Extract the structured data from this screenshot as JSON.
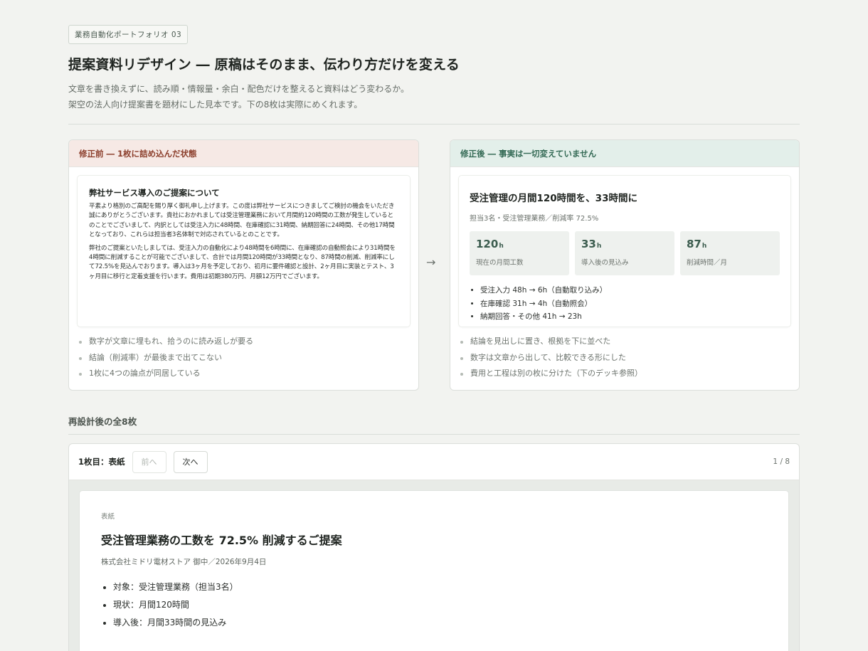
{
  "header": {
    "badge": "業務自動化ポートフォリオ 03",
    "title": "提案資料リデザイン ― 原稿はそのまま、伝わり方だけを変える",
    "lead_1": "文章を書き換えずに、読み順・情報量・余白・配色だけを整えると資料はどう変わるか。",
    "lead_2": "架空の法人向け提案書を題材にした見本です。下の8枚は実際にめくれます。"
  },
  "before": {
    "head": "修正前 ― 1枚に詰め込んだ状態",
    "slide_title": "弊社サービス導入のご提案について",
    "para_1": "平素より格別のご高配を賜り厚く御礼申し上げます。この度は弊社サービスにつきましてご検討の機会をいただき誠にありがとうございます。貴社におかれましては受注管理業務において月間約120時間の工数が発生しているとのことでございまして、内訳としては受注入力に48時間、在庫確認に31時間、納期回答に24時間、その他17時間となっており、これらは担当者3名体制で対応されているとのことです。",
    "para_2": "弊社のご提案といたしましては、受注入力の自動化により48時間を6時間に、在庫確認の自動照会により31時間を4時間に削減することが可能でございまして、合計では月間120時間が33時間となり、87時間の削減、削減率にして72.5%を見込んでおります。導入は3ヶ月を予定しており、初月に要件確認と設計、2ヶ月目に実装とテスト、3ヶ月目に移行と定着支援を行います。費用は初期380万円、月額12万円でございます。",
    "notes": [
      "数字が文章に埋もれ、拾うのに読み返しが要る",
      "結論（削減率）が最後まで出てこない",
      "1枚に4つの論点が同居している"
    ]
  },
  "after": {
    "head": "修正後 ― 事実は一切変えていません",
    "slide_title": "受注管理の月間120時間を、33時間に",
    "slide_sub": "担当3名・受注管理業務／削減率 72.5%",
    "stats": [
      {
        "value": "120",
        "unit": "h",
        "label": "現在の月間工数"
      },
      {
        "value": "33",
        "unit": "h",
        "label": "導入後の見込み"
      },
      {
        "value": "87",
        "unit": "h",
        "label": "削減時間／月"
      }
    ],
    "bullets": [
      "受注入力 48h → 6h（自動取り込み）",
      "在庫確認 31h → 4h（自動照会）",
      "納期回答・その他 41h → 23h"
    ],
    "notes": [
      "結論を見出しに置き、根拠を下に並べた",
      "数字は文章から出して、比較できる形にした",
      "費用と工程は別の枚に分けた（下のデッキ参照）"
    ]
  },
  "arrow": "→",
  "deck": {
    "section_title": "再設計後の全8枚",
    "current_label": "1枚目：表紙",
    "prev_label": "前へ",
    "next_label": "次へ",
    "counter": "1 / 8",
    "slide": {
      "kicker": "表紙",
      "title": "受注管理業務の工数を 72.5% 削減するご提案",
      "subtitle": "株式会社ミドリ電材ストア 御中／2026年9月4日",
      "bullets": [
        "対象：受注管理業務（担当3名）",
        "現状：月間120時間",
        "導入後：月間33時間の見込み"
      ]
    }
  }
}
